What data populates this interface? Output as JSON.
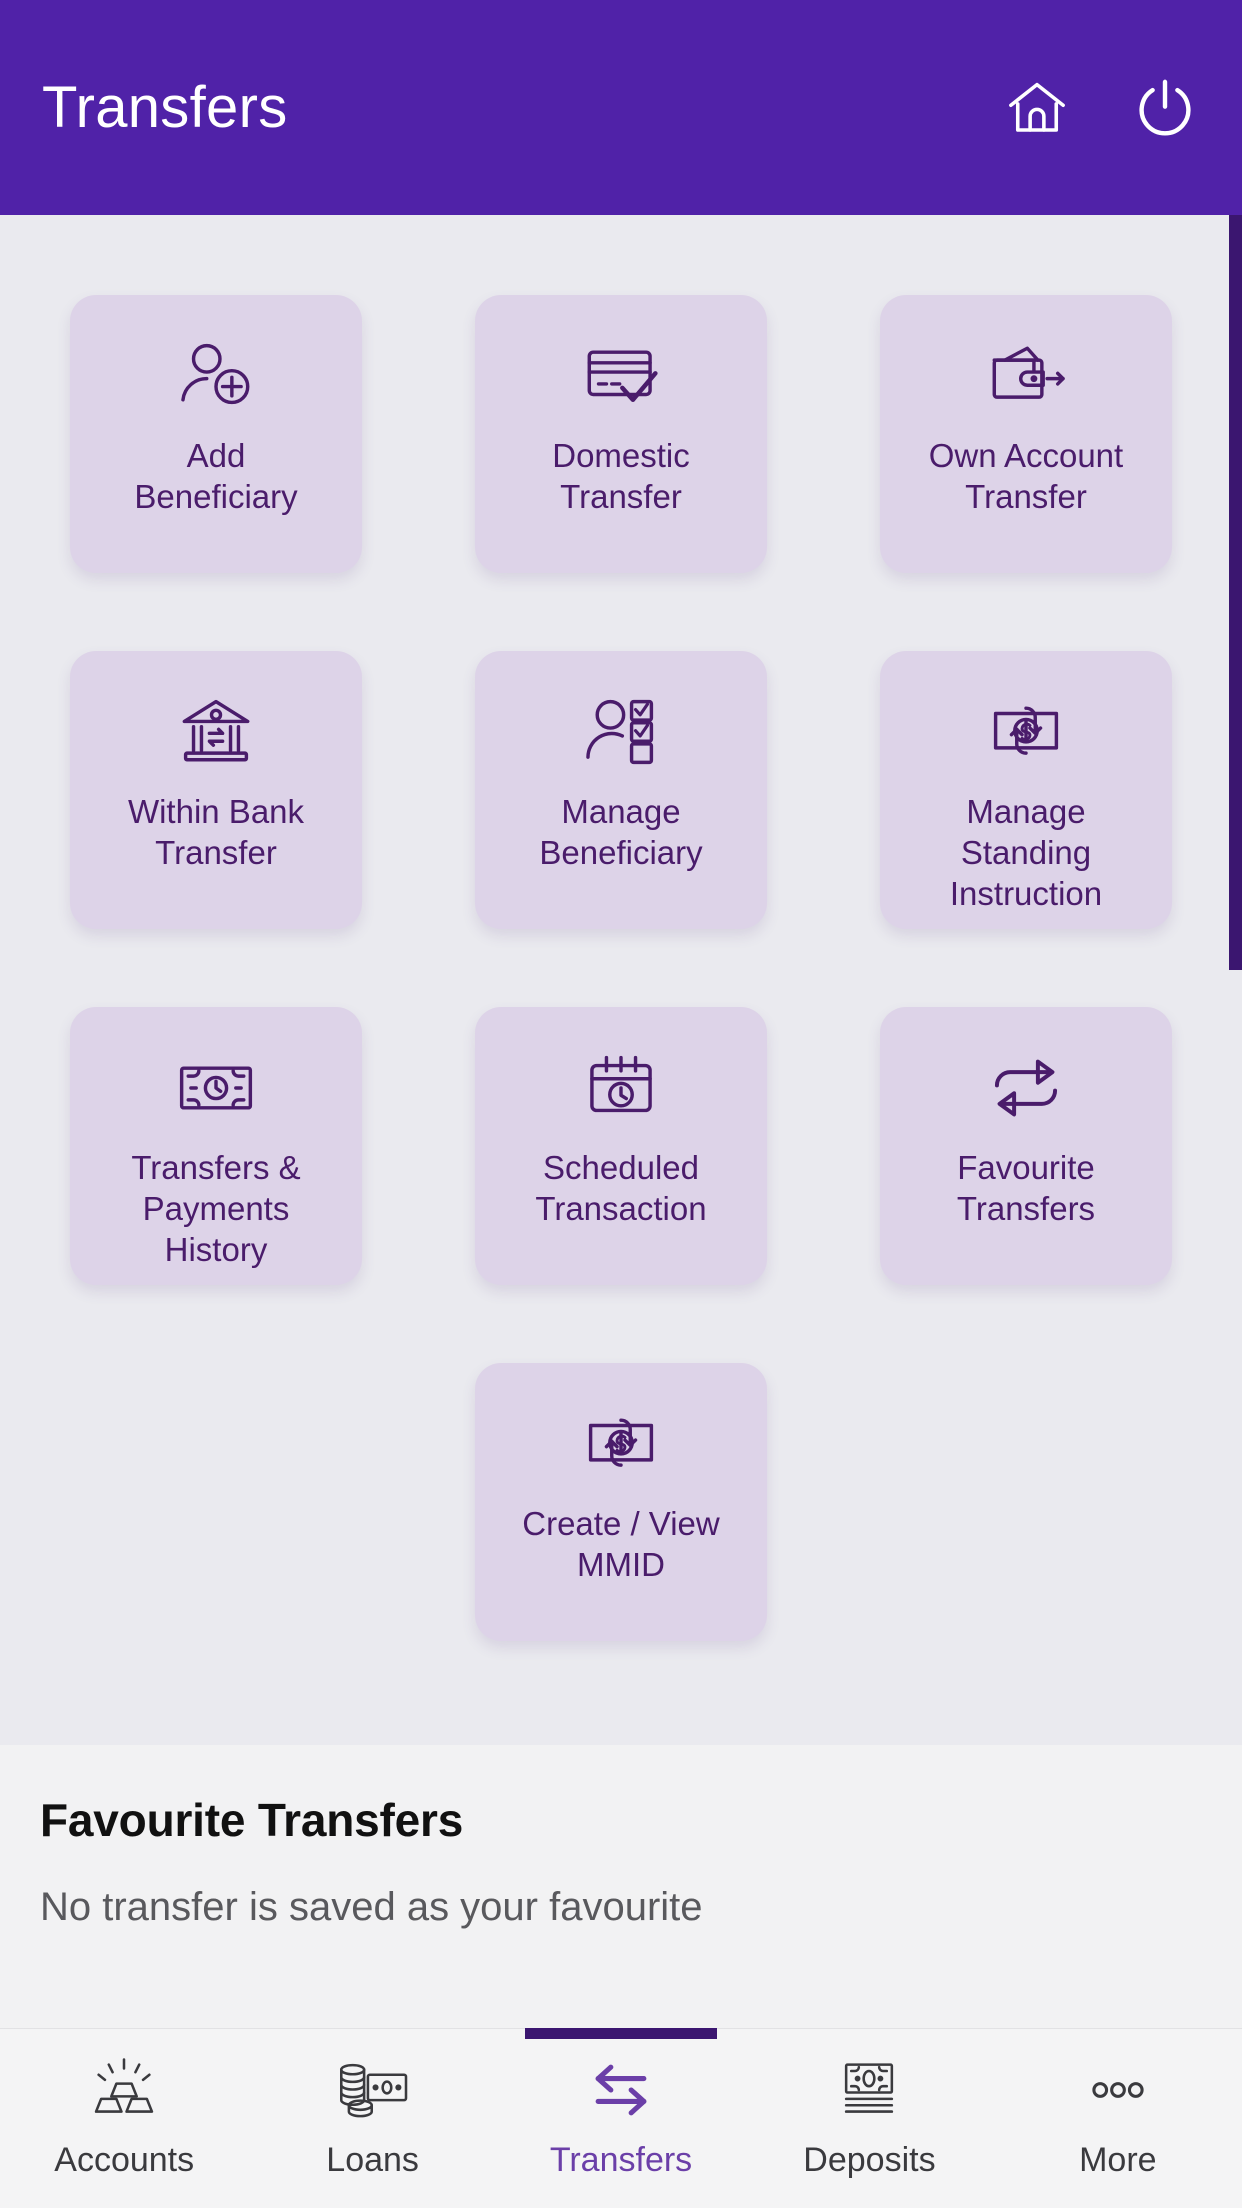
{
  "header": {
    "title": "Transfers",
    "home_icon": "home-icon",
    "power_icon": "power-icon",
    "bg_color": "#5022a8",
    "text_color": "#ffffff"
  },
  "theme": {
    "brand_purple": "#5022a8",
    "dark_purple": "#3b1670",
    "tile_bg": "#ddd3e8",
    "tile_fg": "#4a1c6b",
    "content_bg": "#eaeaef",
    "panel_bg": "#f2f2f3",
    "nav_active": "#6b3fa8",
    "nav_inactive": "#3a3a3e"
  },
  "grid": {
    "rows": [
      [
        {
          "label": "Add\nBeneficiary",
          "icon": "user-add-icon"
        },
        {
          "label": "Domestic\nTransfer",
          "icon": "card-check-icon"
        },
        {
          "label": "Own Account\nTransfer",
          "icon": "wallet-arrow-icon"
        }
      ],
      [
        {
          "label": "Within Bank\nTransfer",
          "icon": "bank-exchange-icon"
        },
        {
          "label": "Manage\nBeneficiary",
          "icon": "user-checklist-icon"
        },
        {
          "label": "Manage\nStanding\nInstruction",
          "icon": "banknote-recurring-icon"
        }
      ],
      [
        {
          "label": "Transfers &\nPayments\nHistory",
          "icon": "banknote-clock-icon"
        },
        {
          "label": "Scheduled\nTransaction",
          "icon": "calendar-clock-icon"
        },
        {
          "label": "Favourite\nTransfers",
          "icon": "repeat-arrows-icon"
        }
      ],
      [
        {
          "label": "Create / View\nMMID",
          "icon": "banknote-recurring-icon"
        }
      ]
    ]
  },
  "favourites": {
    "title": "Favourite Transfers",
    "empty_message": "No transfer is saved as your favourite"
  },
  "bottom_nav": {
    "items": [
      {
        "label": "Accounts",
        "icon": "gold-bars-icon",
        "active": false
      },
      {
        "label": "Loans",
        "icon": "coins-note-icon",
        "active": false
      },
      {
        "label": "Transfers",
        "icon": "transfer-arrows-icon",
        "active": true
      },
      {
        "label": "Deposits",
        "icon": "banknote-stack-icon",
        "active": false
      },
      {
        "label": "More",
        "icon": "ellipsis-icon",
        "active": false
      }
    ]
  }
}
